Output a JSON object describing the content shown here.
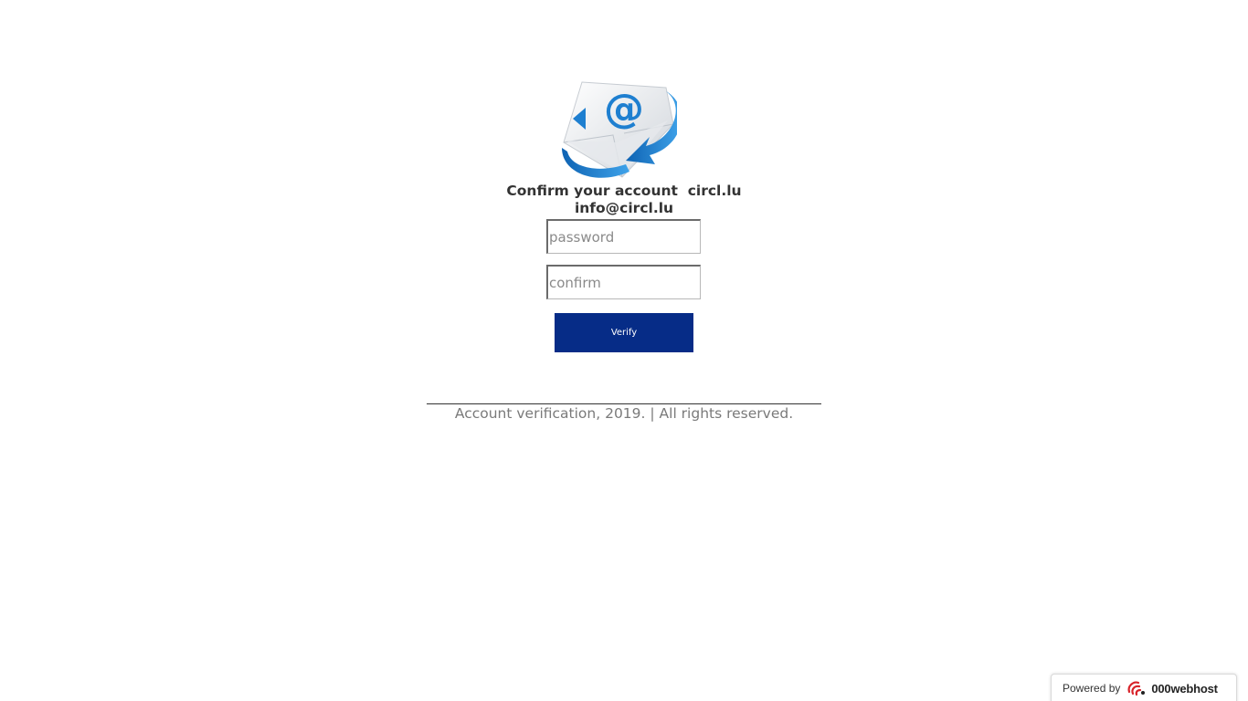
{
  "header": {
    "title_line1": "Confirm your account  circl.lu",
    "title_line2": "info@circl.lu"
  },
  "form": {
    "password_placeholder": "password",
    "confirm_placeholder": "confirm",
    "verify_label": "Verify"
  },
  "footer": {
    "text": "Account verification, 2019. | All rights reserved."
  },
  "badge": {
    "label": "Powered by",
    "brand": "000webhost",
    "logo_icon": "000webhost-logo-icon"
  },
  "logo": {
    "icon": "email-envelope-icon",
    "glyph": "@"
  },
  "colors": {
    "button_bg": "#062c87",
    "button_text": "#ffffff",
    "heading_text": "#333333",
    "footer_text": "#7a7a7a",
    "logo_blue": "#1e7fd0",
    "badge_accent": "#d8232a"
  }
}
